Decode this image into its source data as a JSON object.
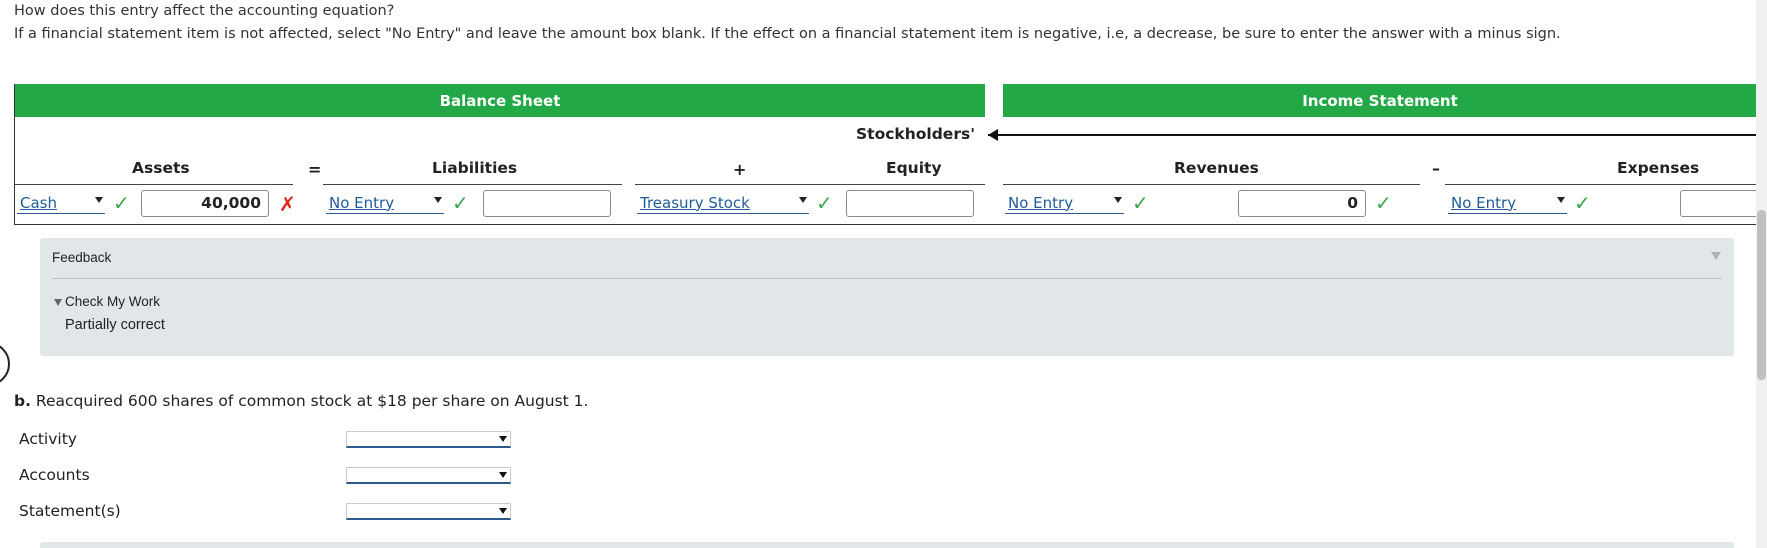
{
  "intro": {
    "question": "How does this entry affect the accounting equation?",
    "instructions": "If a financial statement item is not affected, select \"No Entry\" and leave the amount box blank. If the effect on a financial statement item is negative, i.e, a decrease, be sure to enter the answer with a minus sign."
  },
  "table": {
    "balance_sheet_title": "Balance Sheet",
    "income_statement_title": "Income Statement",
    "stockholders_label": "Stockholders'",
    "columns": {
      "assets": "Assets",
      "equals": "=",
      "liabilities": "Liabilities",
      "plus": "+",
      "equity": "Equity",
      "revenues": "Revenues",
      "minus": "–",
      "expenses": "Expenses"
    },
    "row": {
      "assets_account": "Cash",
      "assets_amount": "40,000",
      "assets_result": "incorrect",
      "liabilities_account": "No Entry",
      "liabilities_amount": "",
      "equity_account": "Treasury Stock",
      "equity_amount": "",
      "revenues_account": "No Entry",
      "revenues_amount": "0",
      "expenses_account": "No Entry",
      "expenses_amount": ""
    }
  },
  "feedback": {
    "title": "Feedback",
    "check_label": "Check My Work",
    "result": "Partially correct"
  },
  "part_b": {
    "label": "b.",
    "text": "Reacquired 600 shares of common stock at $18 per share on August 1.",
    "fields": [
      {
        "label": "Activity",
        "value": ""
      },
      {
        "label": "Accounts",
        "value": ""
      },
      {
        "label": "Statement(s)",
        "value": ""
      }
    ]
  },
  "colors": {
    "header_green": "#22a847",
    "check_green": "#3aa84a",
    "error_red": "#e0241b",
    "link_blue": "#1f5c99",
    "feedback_bg": "#e1e6e9"
  }
}
